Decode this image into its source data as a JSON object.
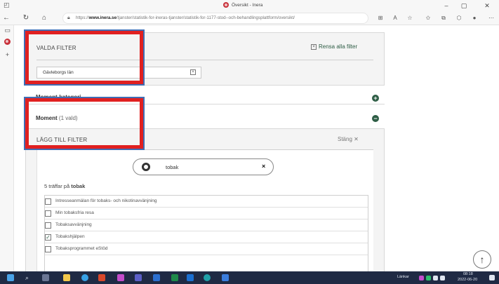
{
  "browser": {
    "tab_title": "Översikt - Inera",
    "url_prefix": "https://",
    "url_domain": "www.inera.se",
    "url_path": "/tjanster/statistik-for-ineras-tjanster/statistik-for-1177-stod--och-behandlingsplattform/oversikt/",
    "min_label": "–",
    "max_label": "▢",
    "close_label": "✕"
  },
  "filters": {
    "heading": "VALDA FILTER",
    "clear_all_label": "Rensa alla filter",
    "active_chip": "Gävleborgs län"
  },
  "collapsed_section": {
    "label": "Moment-kategori"
  },
  "moment": {
    "title": "Moment",
    "selected_count": "(1 vald)",
    "add_filter_label": "LÄGG TILL FILTER",
    "close_label": "Stäng",
    "search_value": "tobak",
    "results_prefix": "5 träffar på",
    "results_term": "tobak",
    "options": [
      {
        "label": "Intresseanmälan för tobaks- och nikotinavvänjning",
        "checked": false
      },
      {
        "label": "Min tobaksfria resa",
        "checked": false
      },
      {
        "label": "Tobaksavvänjning",
        "checked": false
      },
      {
        "label": "Tobakshjälpen",
        "checked": true
      },
      {
        "label": "Tobaksprogrammet eStöd",
        "checked": false
      }
    ]
  },
  "taskbar": {
    "links_label": "Länkar",
    "time": "08:18",
    "date": "2022-06-20"
  },
  "colors": {
    "accent_green": "#2e5d45",
    "highlight_red": "#e02020",
    "highlight_blue": "#3f6db5",
    "taskbar_bg": "#1f2a44",
    "inera_red": "#c8313a"
  }
}
